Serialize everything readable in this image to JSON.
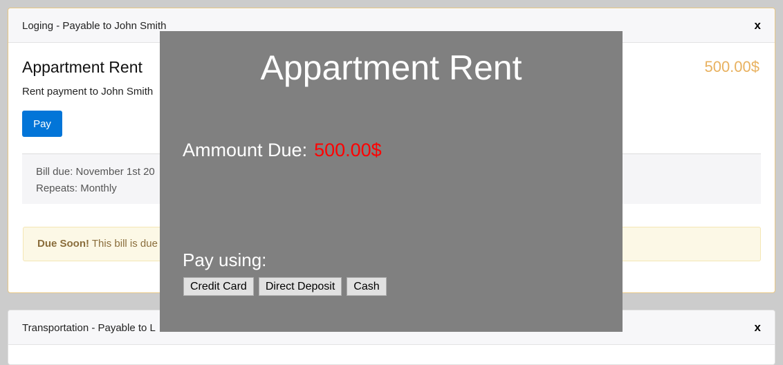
{
  "bills": [
    {
      "header_title": "Loging - Payable to John Smith",
      "close_label": "x",
      "name": "Appartment Rent",
      "amount": "500.00$",
      "description": "Rent payment to John Smith",
      "pay_label": "Pay",
      "bill_due": "Bill due: November 1st 20",
      "repeats": "Repeats: Monthly",
      "alert_strong": "Due Soon!",
      "alert_text": " This bill is due"
    },
    {
      "header_title": "Transportation - Payable to L",
      "close_label": "x"
    }
  ],
  "modal": {
    "title": "Appartment Rent",
    "amount_due_label": "Ammount Due:",
    "amount_due_value": "500.00$",
    "pay_using_label": "Pay using:",
    "methods": [
      "Credit Card",
      "Direct Deposit",
      "Cash"
    ]
  },
  "colors": {
    "amount_accent": "#e8b15f",
    "primary_button": "#0275d8",
    "modal_bg": "#808080",
    "amount_due_red": "#ff0000",
    "card_highlight_border": "#e8c783"
  }
}
